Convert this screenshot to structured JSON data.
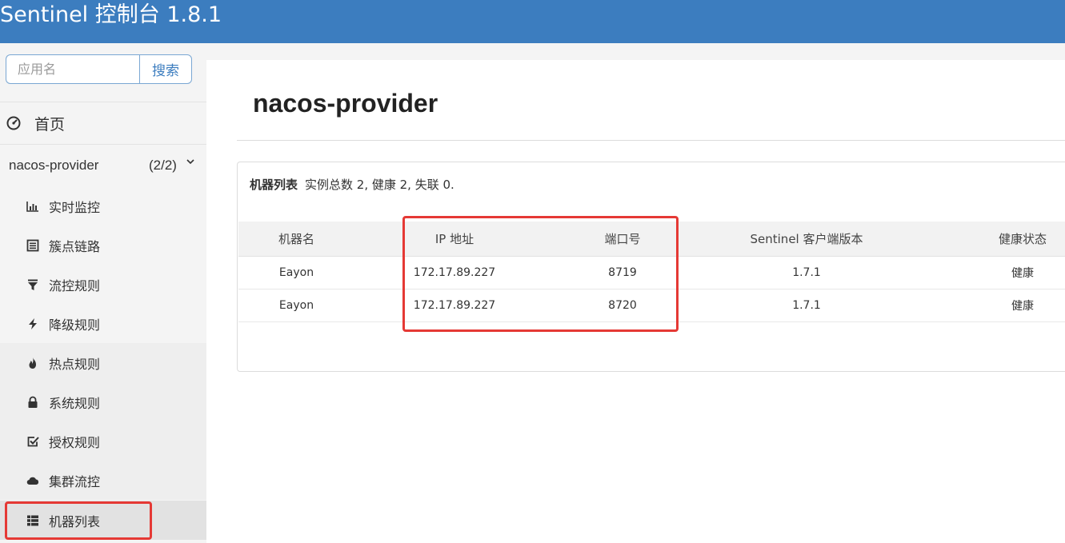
{
  "header": {
    "title": "Sentinel 控制台 1.8.1"
  },
  "search": {
    "placeholder": "应用名",
    "button_label": "搜索"
  },
  "nav": {
    "home_label": "首页",
    "app": {
      "name": "nacos-provider",
      "count": "(2/2)"
    },
    "items": [
      {
        "label": "实时监控",
        "icon": "bar-chart-icon"
      },
      {
        "label": "簇点链路",
        "icon": "list-alt-icon"
      },
      {
        "label": "流控规则",
        "icon": "filter-icon"
      },
      {
        "label": "降级规则",
        "icon": "flash-icon"
      },
      {
        "label": "热点规则",
        "icon": "fire-icon"
      },
      {
        "label": "系统规则",
        "icon": "lock-icon"
      },
      {
        "label": "授权规则",
        "icon": "check-icon"
      },
      {
        "label": "集群流控",
        "icon": "cloud-icon"
      },
      {
        "label": "机器列表",
        "icon": "th-list-icon"
      }
    ]
  },
  "main": {
    "title": "nacos-provider",
    "panel": {
      "title": "机器列表",
      "summary": "实例总数 2, 健康 2, 失联 0."
    },
    "table": {
      "columns": [
        "机器名",
        "IP 地址",
        "端口号",
        "Sentinel 客户端版本",
        "健康状态"
      ],
      "rows": [
        [
          "Eayon",
          "172.17.89.227",
          "8719",
          "1.7.1",
          "健康"
        ],
        [
          "Eayon",
          "172.17.89.227",
          "8720",
          "1.7.1",
          "健康"
        ]
      ]
    }
  },
  "colors": {
    "header_bg": "#3c7dbf",
    "highlight": "#e53935"
  }
}
